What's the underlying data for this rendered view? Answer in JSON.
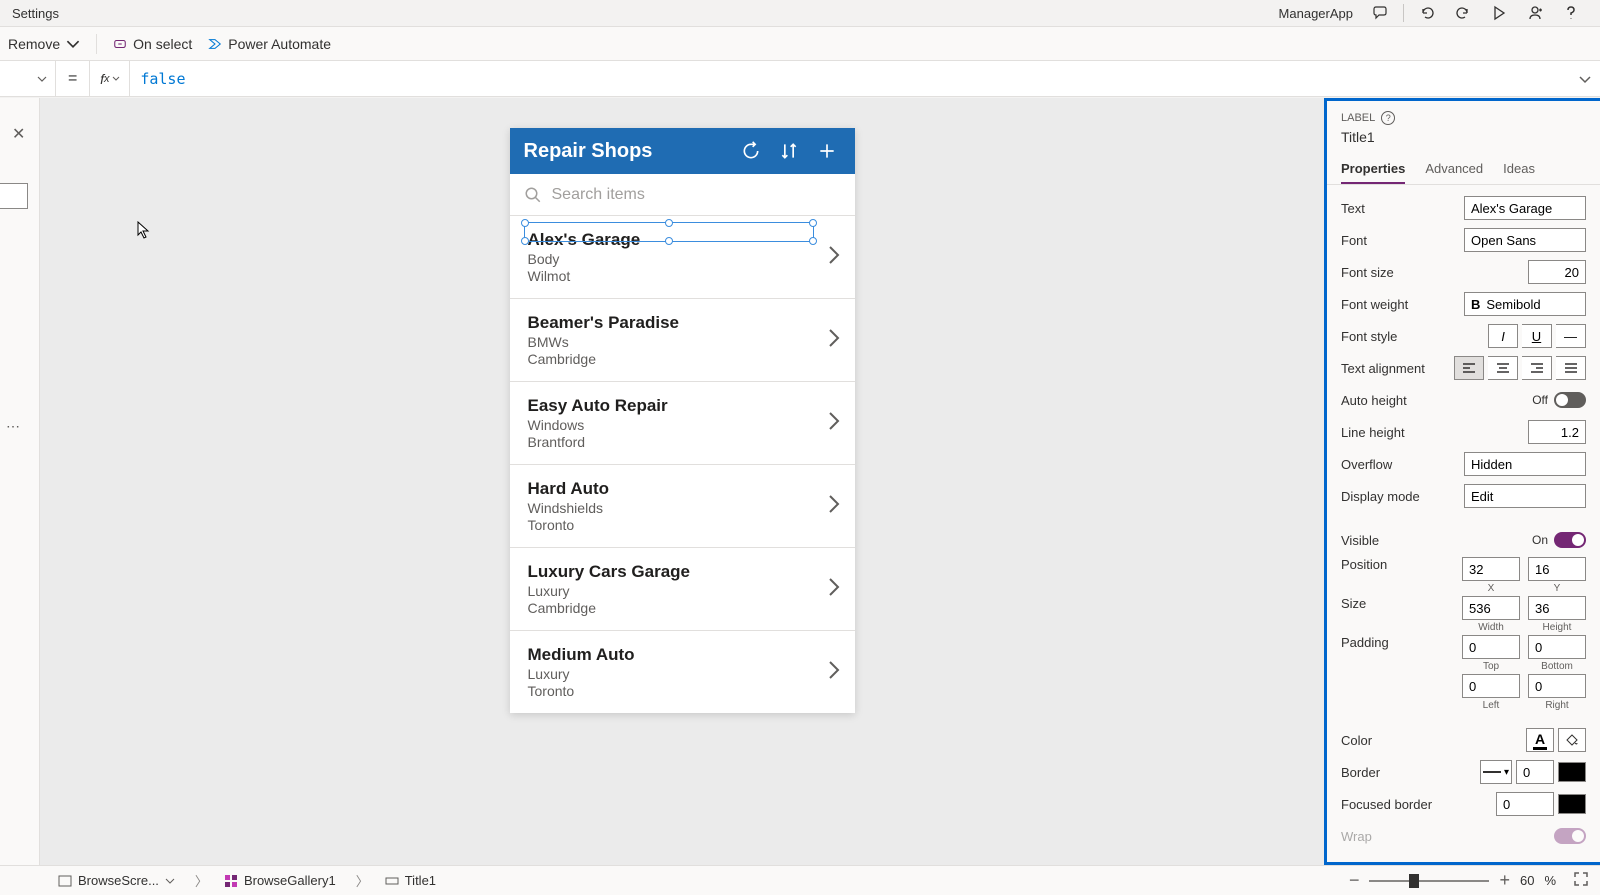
{
  "titlebar": {
    "title": "Settings",
    "app": "ManagerApp"
  },
  "toolbar": {
    "remove": "Remove",
    "on_select": "On select",
    "power_automate": "Power Automate"
  },
  "formula": {
    "fx": "fx",
    "value": "false"
  },
  "phone": {
    "title": "Repair Shops",
    "search_placeholder": "Search items",
    "items": [
      {
        "title": "Alex's Garage",
        "sub1": "Body",
        "sub2": "Wilmot"
      },
      {
        "title": "Beamer's Paradise",
        "sub1": "BMWs",
        "sub2": "Cambridge"
      },
      {
        "title": "Easy Auto Repair",
        "sub1": "Windows",
        "sub2": "Brantford"
      },
      {
        "title": "Hard Auto",
        "sub1": "Windshields",
        "sub2": "Toronto"
      },
      {
        "title": "Luxury Cars Garage",
        "sub1": "Luxury",
        "sub2": "Cambridge"
      },
      {
        "title": "Medium Auto",
        "sub1": "Luxury",
        "sub2": "Toronto"
      }
    ]
  },
  "props": {
    "label": "LABEL",
    "name": "Title1",
    "tabs": {
      "p": "Properties",
      "a": "Advanced",
      "i": "Ideas"
    },
    "text": {
      "k": "Text",
      "v": "Alex's Garage"
    },
    "font": {
      "k": "Font",
      "v": "Open Sans"
    },
    "font_size": {
      "k": "Font size",
      "v": "20"
    },
    "font_weight": {
      "k": "Font weight",
      "v": "Semibold"
    },
    "font_style": {
      "k": "Font style"
    },
    "text_align": {
      "k": "Text alignment"
    },
    "auto_height": {
      "k": "Auto height",
      "v": "Off"
    },
    "line_height": {
      "k": "Line height",
      "v": "1.2"
    },
    "overflow": {
      "k": "Overflow",
      "v": "Hidden"
    },
    "display_mode": {
      "k": "Display mode",
      "v": "Edit"
    },
    "visible": {
      "k": "Visible",
      "v": "On"
    },
    "position": {
      "k": "Position",
      "x": "32",
      "y": "16",
      "xl": "X",
      "yl": "Y"
    },
    "size": {
      "k": "Size",
      "w": "536",
      "h": "36",
      "wl": "Width",
      "hl": "Height"
    },
    "padding": {
      "k": "Padding",
      "t": "0",
      "b": "0",
      "l": "0",
      "r": "0",
      "tl": "Top",
      "bl": "Bottom",
      "ll": "Left",
      "rl": "Right"
    },
    "color": {
      "k": "Color"
    },
    "border": {
      "k": "Border",
      "v": "0"
    },
    "focused_border": {
      "k": "Focused border",
      "v": "0"
    },
    "wrap": {
      "k": "Wrap"
    }
  },
  "breadcrumb": {
    "b1": "BrowseScre...",
    "b2": "BrowseGallery1",
    "b3": "Title1"
  },
  "zoom": {
    "pct": "60",
    "unit": "%"
  }
}
